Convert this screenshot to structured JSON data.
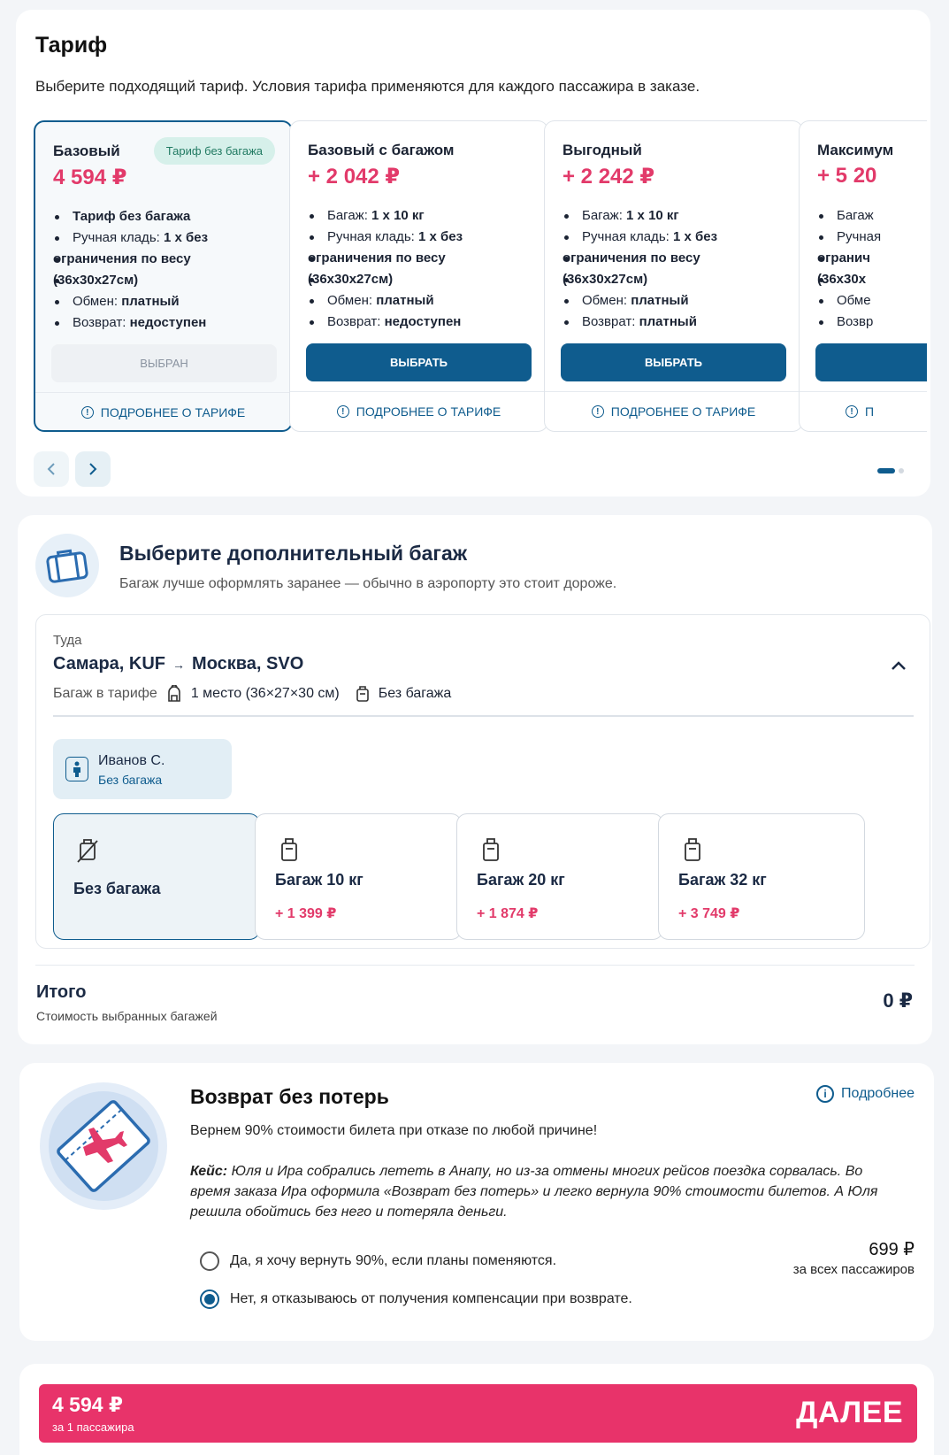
{
  "tariff": {
    "title": "Тариф",
    "subtitle": "Выберите подходящий тариф. Условия тарифа применяются для каждого пассажира в заказе.",
    "cards": [
      {
        "name": "Базовый",
        "price": "4 594 ₽",
        "badge": "Тариф без багажа",
        "f1": "Тариф без багажа",
        "hand_label": "Ручная кладь:",
        "hand_value_a": "1 х без",
        "hand_value_b": "ограничения по весу",
        "hand_value_c": "(36х30х27см)",
        "exchange_label": "Обмен:",
        "exchange_value": "платный",
        "refund_label": "Возврат:",
        "refund_value": "недоступен",
        "button": "ВЫБРАН",
        "more": "ПОДРОБНЕЕ О ТАРИФЕ"
      },
      {
        "name": "Базовый с багажом",
        "price": "+ 2 042 ₽",
        "bag_label": "Багаж:",
        "bag_value": "1 х 10 кг",
        "hand_label": "Ручная кладь:",
        "hand_value_a": "1 х без",
        "hand_value_b": "ограничения по весу",
        "hand_value_c": "(36х30х27см)",
        "exchange_label": "Обмен:",
        "exchange_value": "платный",
        "refund_label": "Возврат:",
        "refund_value": "недоступен",
        "button": "ВЫБРАТЬ",
        "more": "ПОДРОБНЕЕ О ТАРИФЕ"
      },
      {
        "name": "Выгодный",
        "price": "+ 2 242 ₽",
        "bag_label": "Багаж:",
        "bag_value": "1 х 10 кг",
        "hand_label": "Ручная кладь:",
        "hand_value_a": "1 х без",
        "hand_value_b": "ограничения по весу",
        "hand_value_c": "(36х30х27см)",
        "exchange_label": "Обмен:",
        "exchange_value": "платный",
        "refund_label": "Возврат:",
        "refund_value": "платный",
        "button": "ВЫБРАТЬ",
        "more": "ПОДРОБНЕЕ О ТАРИФЕ"
      },
      {
        "name": "Максимум",
        "price": "+ 5 20",
        "f1": "Багаж",
        "f2": "Ручная",
        "f3": "огранич",
        "f4": "(36х30х",
        "f5": "Обме",
        "f6": "Возвр",
        "more": "П"
      }
    ]
  },
  "baggage": {
    "title": "Выберите дополнительный багаж",
    "subtitle": "Багаж лучше оформлять заранее — обычно в аэропорту это стоит дороже.",
    "direction": "Туда",
    "from": "Самара, KUF",
    "arrow": "→",
    "to": "Москва, SVO",
    "included_label": "Багаж в тарифе",
    "hand": "1 место (36×27×30 см)",
    "checked": "Без багажа",
    "passenger": {
      "name": "Иванов С.",
      "status": "Без багажа"
    },
    "options": [
      {
        "label": "Без багажа",
        "price": ""
      },
      {
        "label": "Багаж 10 кг",
        "price": "+ 1 399 ₽"
      },
      {
        "label": "Багаж 20 кг",
        "price": "+ 1 874 ₽"
      },
      {
        "label": "Багаж 32 кг",
        "price": "+ 3 749 ₽"
      }
    ],
    "total_label": "Итого",
    "total_sub": "Стоимость выбранных багажей",
    "total_value": "0 ₽"
  },
  "refund": {
    "title": "Возврат без потерь",
    "more": "Подробнее",
    "desc": "Вернем 90% стоимости билета при отказе по любой причине!",
    "case_label": "Кейс:",
    "case_text": "Юля и Ира собрались лететь в Анапу, но из-за отмены многих рейсов поездка сорвалась. Во время заказа Ира оформила «Возврат без потерь» и легко вернула 90% стоимости билетов. А Юля решила обойтись без него и потеряла деньги.",
    "option_yes": "Да, я хочу вернуть 90%, если планы поменяются.",
    "option_no": "Нет, я отказываюсь от получения компенсации при возврате.",
    "price": "699 ₽",
    "price_note": "за всех пассажиров"
  },
  "footer": {
    "price": "4 594 ₽",
    "sub": "за 1 пассажира",
    "next": "ДАЛЕЕ"
  },
  "colors": {
    "accent": "#0f5c8e",
    "price": "#e23a6a",
    "cta": "#e8336a",
    "badge_bg": "#d6f0ea"
  }
}
